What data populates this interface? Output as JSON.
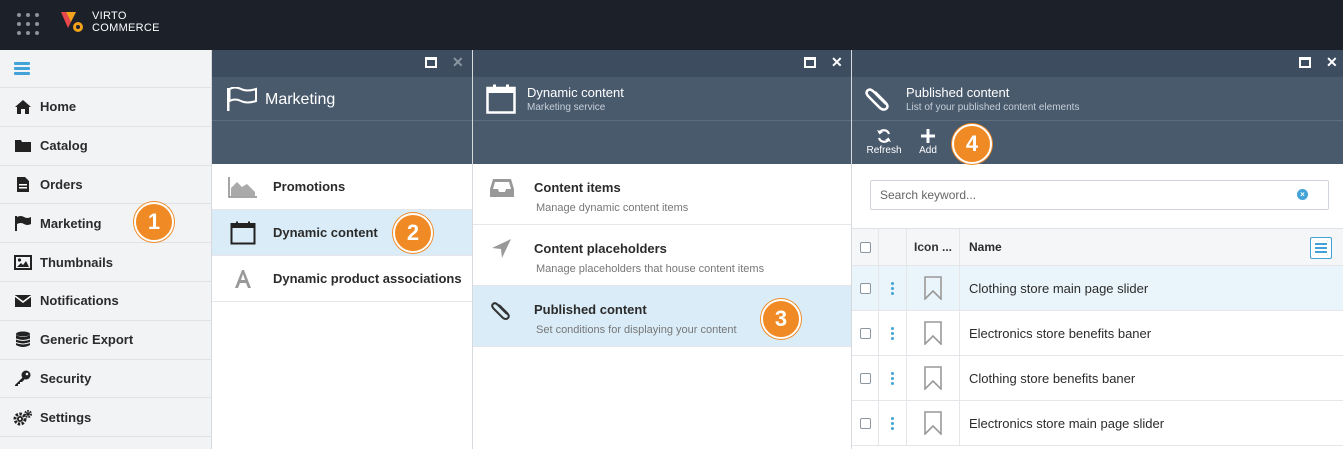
{
  "brand": {
    "line1": "VIRTO",
    "line2": "COMMERCE"
  },
  "sidebar": {
    "items": [
      {
        "label": "Home",
        "icon": "home-icon"
      },
      {
        "label": "Catalog",
        "icon": "folder-icon"
      },
      {
        "label": "Orders",
        "icon": "document-icon"
      },
      {
        "label": "Marketing",
        "icon": "flag-icon"
      },
      {
        "label": "Thumbnails",
        "icon": "image-icon"
      },
      {
        "label": "Notifications",
        "icon": "envelope-icon"
      },
      {
        "label": "Generic Export",
        "icon": "database-icon"
      },
      {
        "label": "Security",
        "icon": "key-icon"
      },
      {
        "label": "Settings",
        "icon": "cogs-icon"
      }
    ]
  },
  "marketing_blade": {
    "title": "Marketing",
    "items": [
      {
        "label": "Promotions",
        "icon": "area-chart-icon"
      },
      {
        "label": "Dynamic content",
        "icon": "calendar-icon",
        "active": true
      },
      {
        "label": "Dynamic product associations",
        "icon": "font-icon"
      }
    ]
  },
  "dynamic_blade": {
    "title": "Dynamic content",
    "subtitle": "Marketing service",
    "items": [
      {
        "title": "Content items",
        "desc": "Manage dynamic content items",
        "icon": "inbox-icon"
      },
      {
        "title": "Content placeholders",
        "desc": "Manage placeholders that house content items",
        "icon": "location-arrow-icon"
      },
      {
        "title": "Published content",
        "desc": "Set conditions for displaying your content",
        "icon": "paperclip-icon",
        "active": true
      }
    ]
  },
  "published_blade": {
    "title": "Published content",
    "subtitle": "List of your published content elements",
    "toolbar": {
      "refresh_label": "Refresh",
      "add_label": "Add"
    },
    "search": {
      "placeholder": "Search keyword..."
    },
    "columns": {
      "icon": "Icon ...",
      "name": "Name"
    },
    "rows": [
      {
        "name": "Clothing store main page slider"
      },
      {
        "name": "Electronics store benefits baner"
      },
      {
        "name": "Clothing store benefits baner"
      },
      {
        "name": "Electronics store main page slider"
      }
    ]
  },
  "callouts": [
    "1",
    "2",
    "3",
    "4"
  ],
  "colors": {
    "accent": "#43a3d8",
    "callout": "#f08a24",
    "topbar": "#1b2029",
    "blade_header": "#4a5a6d",
    "active_row": "#d9ecf7"
  }
}
